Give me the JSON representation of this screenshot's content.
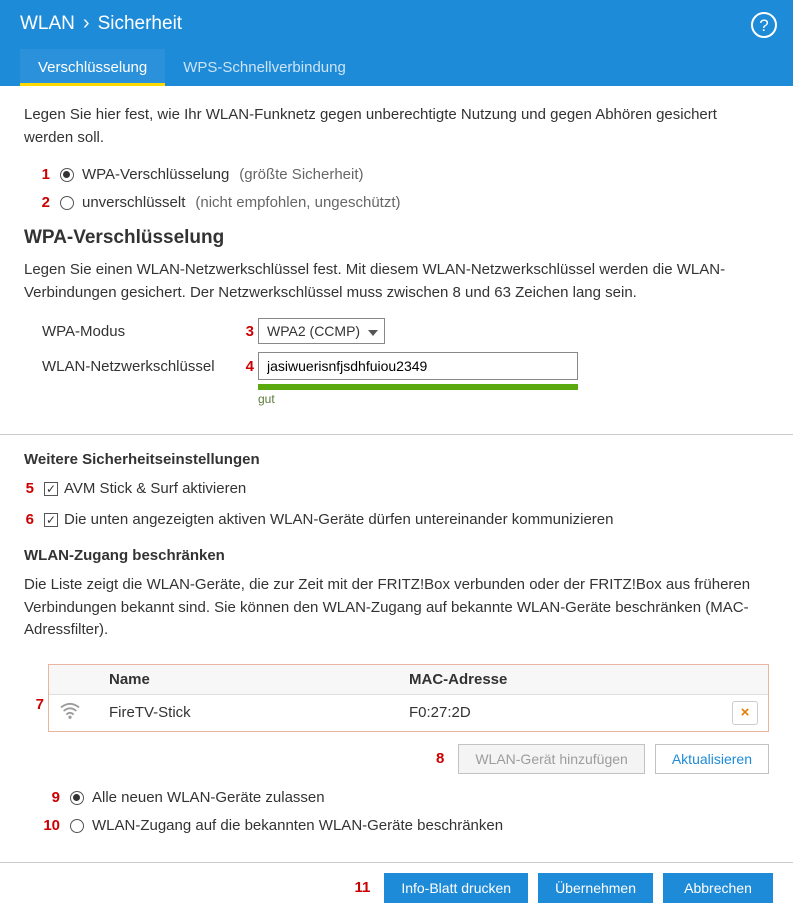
{
  "header": {
    "crumb1": "WLAN",
    "crumb2": "Sicherheit",
    "help": "?"
  },
  "tabs": {
    "t1": "Verschlüsselung",
    "t2": "WPS-Schnellverbindung"
  },
  "intro": "Legen Sie hier fest, wie Ihr WLAN-Funknetz gegen unberechtigte Nutzung und gegen Abhören gesichert werden soll.",
  "annot": {
    "n1": "1",
    "n2": "2",
    "n3": "3",
    "n4": "4",
    "n5": "5",
    "n6": "6",
    "n7": "7",
    "n8": "8",
    "n9": "9",
    "n10": "10",
    "n11": "11"
  },
  "opt1": {
    "label": "WPA-Verschlüsselung",
    "hint": "(größte Sicherheit)"
  },
  "opt2": {
    "label": "unverschlüsselt",
    "hint": "(nicht empfohlen, ungeschützt)"
  },
  "wpa": {
    "heading": "WPA-Verschlüsselung",
    "desc": "Legen Sie einen WLAN-Netzwerkschlüssel fest. Mit diesem WLAN-Netzwerkschlüssel werden die WLAN-Verbindungen gesichert. Der Netzwerkschlüssel muss zwischen 8 und 63 Zeichen lang sein.",
    "mode_label": "WPA-Modus",
    "mode_value": "WPA2 (CCMP)",
    "key_label": "WLAN-Netzwerkschlüssel",
    "key_value": "jasiwuerisnfjsdhfuiou2349",
    "strength": "gut"
  },
  "more": {
    "heading": "Weitere Sicherheitseinstellungen",
    "chk1": "AVM Stick & Surf aktivieren",
    "chk2": "Die unten angezeigten aktiven WLAN-Geräte dürfen untereinander kommunizieren"
  },
  "restrict": {
    "heading": "WLAN-Zugang beschränken",
    "desc": "Die Liste zeigt die WLAN-Geräte, die zur Zeit mit der FRITZ!Box verbunden oder der FRITZ!Box aus früheren Verbindungen bekannt sind. Sie können den WLAN-Zugang auf bekannte WLAN-Geräte beschränken (MAC-Adressfilter).",
    "col_name": "Name",
    "col_mac": "MAC-Adresse",
    "row": {
      "name": "FireTV-Stick",
      "mac": "F0:27:2D",
      "x": "×"
    },
    "btn_add": "WLAN-Gerät hinzufügen",
    "btn_refresh": "Aktualisieren",
    "opt_allow": "Alle neuen WLAN-Geräte zulassen",
    "opt_restrict": "WLAN-Zugang auf die bekannten WLAN-Geräte beschränken"
  },
  "footer": {
    "b1": "Info-Blatt drucken",
    "b2": "Übernehmen",
    "b3": "Abbrechen"
  }
}
